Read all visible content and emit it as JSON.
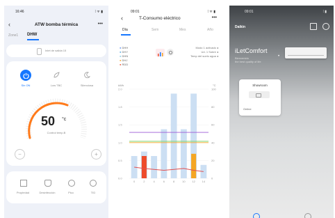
{
  "left": {
    "status_time": "16:46",
    "status_right": "⁞ ᯤ ▮",
    "title": "ATW bomba térmica",
    "menu": "•••",
    "tabs": [
      "Zone1",
      "DHW"
    ],
    "info_text": "Inlet de salida  15",
    "modes": [
      {
        "label": "Sin ON",
        "icon": "power-icon"
      },
      {
        "label": "Low TBC",
        "icon": "leaf-icon"
      },
      {
        "label": "Silenciosa",
        "icon": "moon-icon"
      }
    ],
    "temp_value": "50",
    "temp_unit": "°c",
    "temp_sub": "Control temp.B",
    "bottom_items": [
      {
        "label": "Propiedad",
        "icon": "grid-icon"
      },
      {
        "label": "Desinfección",
        "icon": "shield-icon"
      },
      {
        "label": "Pico",
        "icon": "gauge-icon"
      },
      {
        "label": "TID",
        "icon": "timer-icon"
      }
    ]
  },
  "middle": {
    "status_time": "09:01",
    "status_right": "⁞ ᯤ ▮",
    "title": "T-Consumo eléctrico",
    "menu": "•••",
    "period_tabs": [
      "Día",
      "Sem",
      "Mes",
      "Año"
    ],
    "legend": [
      "DHH",
      "DHY",
      "DHN",
      "DHJ",
      "RDD"
    ],
    "legend_colors": [
      "#5b8def",
      "#4aa3df",
      "#7ec8e3",
      "#f5a623",
      "#ee4b2b"
    ],
    "right_notes": [
      "Modo 1 activado ◂",
      "Ud. 1 Sobre ◂",
      "Temp del suelo agua ◂"
    ],
    "chart_data": {
      "type": "bar",
      "ylabel_left": "kWh",
      "ylabel_right": "°C",
      "y_ticks_left": [
        "2.0",
        "1.8",
        "1.5",
        "1.0",
        "0.5",
        "0.0"
      ],
      "y_ticks_right": [
        "100",
        "80",
        "60",
        "40",
        "20",
        "0"
      ],
      "categories": [
        "0",
        "2",
        "4",
        "6",
        "8",
        "10",
        "12",
        "14"
      ],
      "series": [
        {
          "color": "#ccdff3",
          "values": [
            0.5,
            0.6,
            0.5,
            1.1,
            1.9,
            1.1,
            1.9,
            0.3
          ]
        },
        {
          "color": "#ee4b2b",
          "values": [
            0,
            0.5,
            0,
            0,
            0,
            0,
            0,
            0
          ]
        },
        {
          "color": "#f5a623",
          "values": [
            0,
            0,
            0,
            0,
            0,
            0,
            0.55,
            0
          ]
        },
        {
          "color": "#ef5b5b",
          "values": [
            0,
            0,
            0,
            0,
            0,
            0,
            0,
            0
          ]
        }
      ],
      "lines": [
        {
          "color": "#9b59d6",
          "value": 1.03
        },
        {
          "color": "#7fd36b",
          "value": 0.83
        },
        {
          "color": "#f5a623",
          "value": 0.8
        },
        {
          "color": "#e15050",
          "curve": [
            0.25,
            0.22,
            0.2,
            0.18,
            0.2,
            0.22,
            0.18,
            0.15
          ]
        }
      ],
      "ylim": [
        0,
        2.0
      ]
    }
  },
  "right": {
    "status_time": "09:01",
    "status_right": "⁞ ▮",
    "logo": "Daikin",
    "title": "iLetComfort",
    "sub": "Bienvenido\nthe best quality of life",
    "card_title": "Showroom",
    "card_status": "Online"
  },
  "colors": {
    "accent": "#1677ff",
    "orange": "#ff7a1a"
  }
}
